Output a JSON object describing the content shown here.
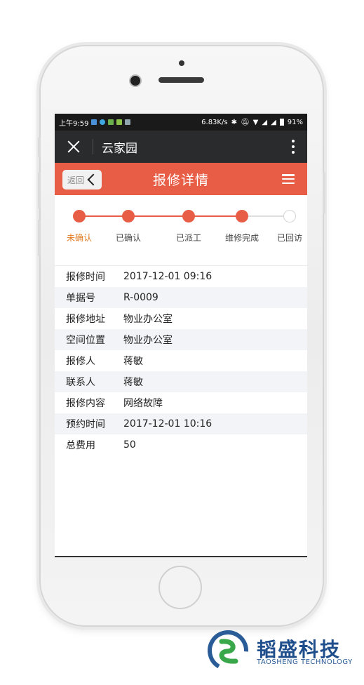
{
  "statusbar": {
    "time": "上午9:59",
    "speed": "6.83K/s",
    "battery": "91%"
  },
  "titlebar": {
    "title": "云家园"
  },
  "header": {
    "back_label": "返回",
    "title": "报修详情"
  },
  "steps": {
    "items": [
      {
        "label": "未确认",
        "done": true,
        "active": true
      },
      {
        "label": "已确认",
        "done": true,
        "active": false
      },
      {
        "label": "已派工",
        "done": true,
        "active": false
      },
      {
        "label": "维修完成",
        "done": true,
        "active": false
      },
      {
        "label": "已回访",
        "done": false,
        "active": false
      }
    ]
  },
  "details": [
    {
      "key": "报修时间",
      "value": "2017-12-01 09:16"
    },
    {
      "key": "单据号",
      "value": "R-0009"
    },
    {
      "key": "报修地址",
      "value": "物业办公室"
    },
    {
      "key": "空间位置",
      "value": "物业办公室"
    },
    {
      "key": "报修人",
      "value": "蒋敏"
    },
    {
      "key": "联系人",
      "value": "蒋敏"
    },
    {
      "key": "报修内容",
      "value": "网络故障"
    },
    {
      "key": "预约时间",
      "value": "2017-12-01 10:16"
    },
    {
      "key": "总费用",
      "value": "50"
    }
  ],
  "logo": {
    "name_cn": "韬盛科技",
    "name_en": "TAOSHENG TECHNOLOGY"
  },
  "colors": {
    "accent": "#e85d45",
    "active_label": "#e07a1f",
    "titlebar": "#2a2b2d",
    "brand_blue": "#1f4e8c",
    "brand_green": "#3aa84a"
  }
}
